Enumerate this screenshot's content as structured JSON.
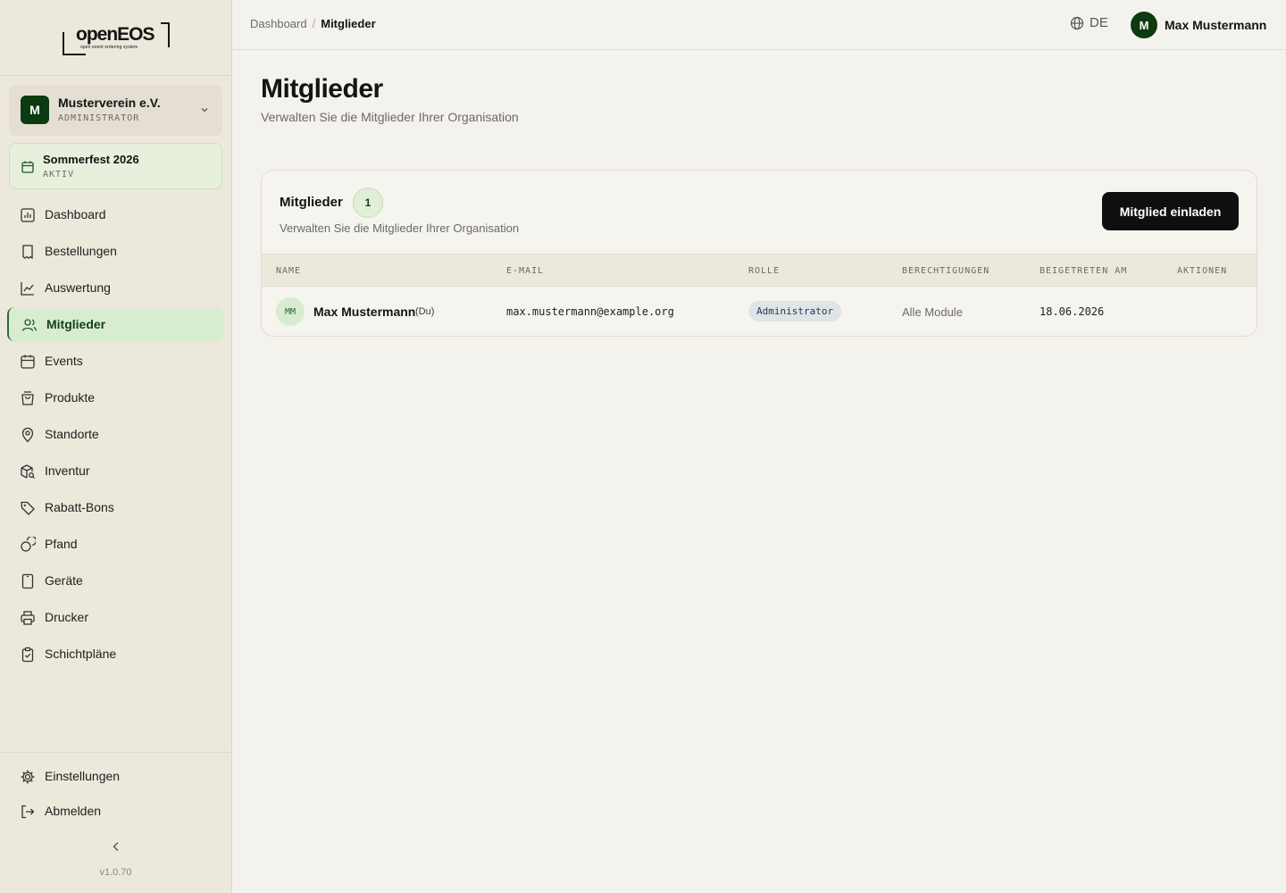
{
  "sidebar": {
    "logo_text": "openEOS",
    "logo_tagline": "open event ordering system",
    "org": {
      "avatar": "M",
      "name": "Musterverein e.V.",
      "role": "ADMINISTRATOR"
    },
    "event": {
      "name": "Sommerfest 2026",
      "status": "AKTIV"
    },
    "items": [
      {
        "label": "Dashboard",
        "icon": "chart-bar-icon"
      },
      {
        "label": "Bestellungen",
        "icon": "receipt-icon"
      },
      {
        "label": "Auswertung",
        "icon": "trend-line-icon"
      },
      {
        "label": "Mitglieder",
        "icon": "users-icon",
        "active": true
      },
      {
        "label": "Events",
        "icon": "calendar-icon"
      },
      {
        "label": "Produkte",
        "icon": "shopping-bag-icon"
      },
      {
        "label": "Standorte",
        "icon": "map-pin-icon"
      },
      {
        "label": "Inventur",
        "icon": "package-search-icon"
      },
      {
        "label": "Rabatt-Bons",
        "icon": "tag-icon"
      },
      {
        "label": "Pfand",
        "icon": "coins-icon"
      },
      {
        "label": "Geräte",
        "icon": "tablet-icon"
      },
      {
        "label": "Drucker",
        "icon": "printer-icon"
      },
      {
        "label": "Schichtpläne",
        "icon": "clipboard-check-icon"
      }
    ],
    "bottom": [
      {
        "label": "Einstellungen",
        "icon": "gear-icon"
      },
      {
        "label": "Abmelden",
        "icon": "logout-icon"
      }
    ],
    "version": "v1.0.70"
  },
  "topbar": {
    "breadcrumb": [
      "Dashboard",
      "Mitglieder"
    ],
    "breadcrumb_sep": "/",
    "lang": "DE",
    "user": {
      "avatar": "M",
      "name": "Max Mustermann"
    }
  },
  "page": {
    "title": "Mitglieder",
    "subtitle": "Verwalten Sie die Mitglieder Ihrer Organisation"
  },
  "card": {
    "title": "Mitglieder",
    "count": "1",
    "description": "Verwalten Sie die Mitglieder Ihrer Organisation",
    "invite_button": "Mitglied einladen",
    "columns": [
      "NAME",
      "E-MAIL",
      "ROLLE",
      "BERECHTIGUNGEN",
      "BEIGETRETEN AM",
      "AKTIONEN"
    ],
    "rows": [
      {
        "initials": "MM",
        "name": "Max Mustermann",
        "self_tag": "(Du)",
        "email": "max.mustermann@example.org",
        "role": "Administrator",
        "permissions": "Alle Module",
        "joined": "18.06.2026"
      }
    ]
  },
  "colors": {
    "brand": "#0c3b12",
    "active_bg": "#d8ecd0",
    "sidebar_bg": "#ede8dc",
    "page_bg": "#f4f2ec"
  }
}
